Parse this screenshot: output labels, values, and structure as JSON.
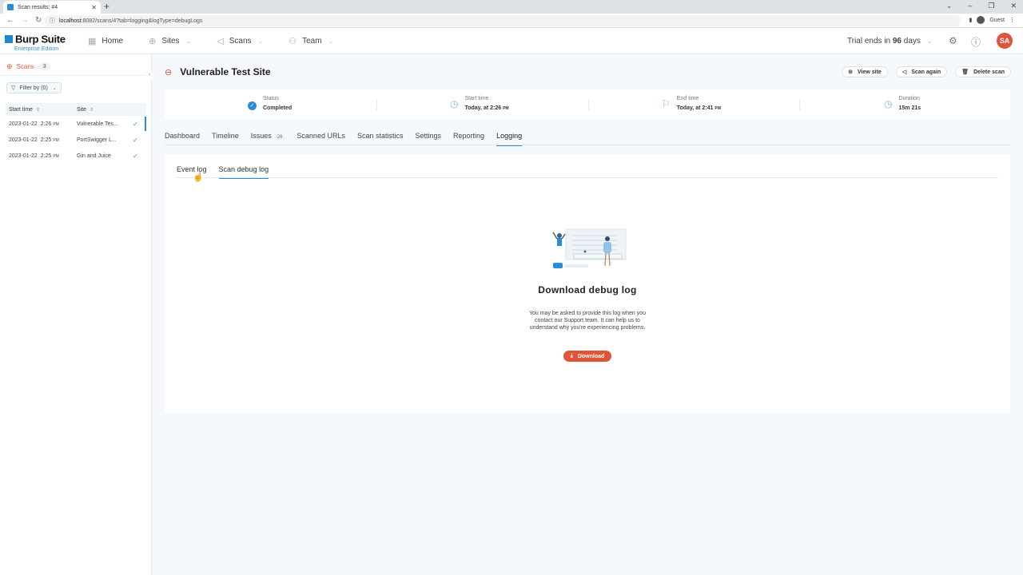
{
  "browser": {
    "tab_title": "Scan results: #4",
    "url_host": "localhost",
    "url_rest": ":8082/scans/4?tab=logging&logType=debugLogs",
    "profile": "Guest"
  },
  "header": {
    "brand": "Burp Suite",
    "edition": "Enterprise Edition",
    "nav": [
      {
        "label": "Home",
        "icon": "home-grid-icon"
      },
      {
        "label": "Sites",
        "icon": "globe-icon"
      },
      {
        "label": "Scans",
        "icon": "scan-icon"
      },
      {
        "label": "Team",
        "icon": "team-icon"
      }
    ],
    "trial_prefix": "Trial ends in ",
    "trial_days": "96",
    "trial_suffix": " days",
    "avatar_initials": "SA"
  },
  "sidebar": {
    "title": "Scans",
    "count": "3",
    "filter_label": "Filter by (0)",
    "columns": [
      "Start time",
      "Site"
    ],
    "rows": [
      {
        "date": "2023-01-22",
        "time": "2:26",
        "ampm": "PM",
        "site": "Vulnerable Tes...",
        "status": "✓"
      },
      {
        "date": "2023-01-22",
        "time": "2:25",
        "ampm": "PM",
        "site": "PortSwigger L...",
        "status": "✓"
      },
      {
        "date": "2023-01-22",
        "time": "2:25",
        "ampm": "PM",
        "site": "Gin and Juice",
        "status": "✓"
      }
    ]
  },
  "scan": {
    "title": "Vulnerable Test Site",
    "actions": {
      "view_site": "View site",
      "scan_again": "Scan again",
      "delete_scan": "Delete scan"
    },
    "summary": {
      "status_label": "Status",
      "status_value": "Completed",
      "start_label": "Start time",
      "start_value": "Today, at 2:26",
      "start_ampm": "PM",
      "end_label": "End time",
      "end_value": "Today, at 2:41",
      "end_ampm": "PM",
      "duration_label": "Duration",
      "duration_value": "15m 21s"
    },
    "tabs": [
      {
        "label": "Dashboard"
      },
      {
        "label": "Timeline"
      },
      {
        "label": "Issues",
        "badge": "26"
      },
      {
        "label": "Scanned URLs"
      },
      {
        "label": "Scan statistics"
      },
      {
        "label": "Settings"
      },
      {
        "label": "Reporting"
      },
      {
        "label": "Logging",
        "active": true
      }
    ],
    "subtabs": [
      {
        "label": "Event log"
      },
      {
        "label": "Scan debug log",
        "active": true
      }
    ],
    "debug": {
      "heading": "Download debug log",
      "body": "You may be asked to provide this log when you contact our Support team. It can help us to understand why you're experiencing problems.",
      "button": "Download"
    }
  },
  "colors": {
    "accent": "#2a8dd4",
    "brand_orange": "#e0553a"
  }
}
